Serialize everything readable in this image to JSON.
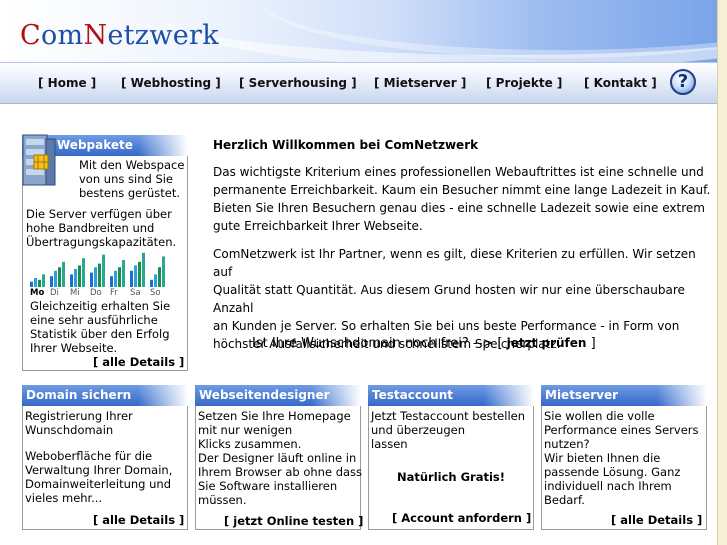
{
  "logo": {
    "c1": "C",
    "rest1": "om",
    "c2": "N",
    "rest2": "etzwerk"
  },
  "nav": [
    "[ Home ]",
    "[ Webhosting ]",
    "[ Serverhousing ]",
    "[ Mietserver ]",
    "[ Projekte ]",
    "[ Kontakt ]"
  ],
  "help_label": "?",
  "webpakete": {
    "title": "Webpakete",
    "intro": [
      "Mit den Webspace",
      "von uns sind Sie",
      "bestens gerüstet."
    ],
    "text1": [
      "Die Server verfügen über",
      "hohe Bandbreiten und",
      "Übertragungskapazitäten."
    ],
    "days": [
      "Mo",
      "Di",
      "Mi",
      "Do",
      "Fr",
      "Sa",
      "So"
    ],
    "text2": [
      "Gleichzeitig erhalten Sie",
      "eine sehr ausführliche",
      "Statistik über den Erfolg",
      "Ihrer Webseite."
    ],
    "link": "[ alle Details ]"
  },
  "stats_chart": {
    "groups": [
      [
        0.15,
        0.25,
        0.2,
        0.35
      ],
      [
        0.3,
        0.45,
        0.55,
        0.7
      ],
      [
        0.35,
        0.5,
        0.6,
        0.8
      ],
      [
        0.4,
        0.55,
        0.65,
        0.9
      ],
      [
        0.3,
        0.45,
        0.55,
        0.75
      ],
      [
        0.45,
        0.6,
        0.7,
        0.95
      ],
      [
        0.2,
        0.35,
        0.55,
        0.85
      ]
    ],
    "colors": [
      "#1a6fcf",
      "#2f9fe0",
      "#1a8f4a",
      "#2aa890"
    ]
  },
  "main": {
    "heading": "Herzlich Willkommen bei ComNetzwerk",
    "para1": [
      "Das wichtigste Kriterium eines professionellen Webauftrittes ist eine schnelle und",
      "permanente Erreichbarkeit. Kaum ein Besucher nimmt eine lange Ladezeit in Kauf.",
      "Bieten Sie Ihren Besuchern genau dies - eine schnelle Ladezeit sowie eine extrem",
      "gute Erreichbarkeit Ihrer Webseite."
    ],
    "para2": [
      "ComNetzwerk ist Ihr Partner, wenn es gilt, diese Kriterien zu erfüllen. Wir setzen auf",
      "Qualität statt Quantität. Aus diesem Grund hosten wir nur eine überschaubare Anzahl",
      "an Kunden je Server. So erhalten Sie bei uns beste Performance - in Form von",
      "höchster Ausfallsicherheit und schnellstem Speicherplatz."
    ],
    "domain_question": "Ist Ihre Wunschdomain noch frei? -->",
    "domain_link_open": "[",
    "domain_link": "jetzt prüfen",
    "domain_link_close": "]"
  },
  "boxes": [
    {
      "title": "Domain sichern",
      "lines": [
        "Registrierung Ihrer",
        "Wunschdomain",
        "",
        "Weboberfläche für die",
        "Verwaltung Ihrer Domain,",
        "Domainweiterleitung und",
        "vieles mehr..."
      ],
      "link": "[ alle Details ]"
    },
    {
      "title": "Webseitendesigner",
      "lines": [
        "Setzen Sie Ihre Homepage",
        "mit nur wenigen",
        "Klicks zusammen.",
        "Der Designer läuft online in",
        "Ihrem Browser ab ohne dass",
        "Sie Software installieren",
        "müssen."
      ],
      "link": "[ jetzt Online testen ]"
    },
    {
      "title": "Testaccount",
      "lines": [
        "Jetzt Testaccount bestellen",
        "und überzeugen",
        "lassen"
      ],
      "highlight": "Natürlich Gratis!",
      "link": "[ Account anfordern ]"
    },
    {
      "title": "Mietserver",
      "lines": [
        "Sie wollen die volle",
        "Performance eines Servers",
        "nutzen?",
        "Wir bieten Ihnen die",
        "passende Lösung. Ganz",
        "individuell nach Ihrem",
        "Bedarf."
      ],
      "link": "[ alle Details ]"
    }
  ]
}
